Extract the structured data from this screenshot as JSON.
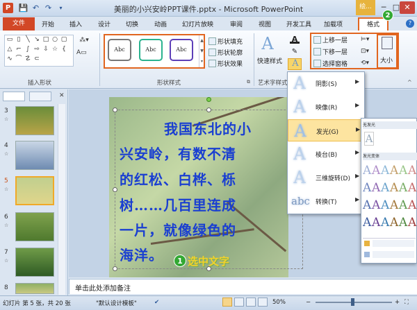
{
  "window": {
    "title": "美丽的小兴安岭PPT课件.pptx - Microsoft PowerPoint",
    "context_tab": "绘..."
  },
  "quick_access": {
    "app_icon": "P",
    "save": "💾",
    "undo": "↶",
    "redo": "↷"
  },
  "tabs": {
    "file": "文件",
    "items": [
      "开始",
      "插入",
      "设计",
      "切换",
      "动画",
      "幻灯片放映",
      "审阅",
      "视图",
      "开发工具",
      "加载项"
    ],
    "format": "格式"
  },
  "badges": {
    "badge1": "1",
    "badge1_text": "选中文字",
    "badge2": "2"
  },
  "ribbon": {
    "insert_shapes_label": "插入形状",
    "shape_styles_label": "形状样式",
    "wordart_label": "艺术字样式",
    "style_thumb": "Abc",
    "fill": "形状填充",
    "outline": "形状轮廓",
    "effects": "形状效果",
    "quick_styles": "快速样式",
    "bring_forward": "上移一层",
    "send_backward": "下移一层",
    "selection_pane": "选择窗格",
    "size": "大小"
  },
  "slides": [
    {
      "num": "3"
    },
    {
      "num": "4"
    },
    {
      "num": "5"
    },
    {
      "num": "6"
    },
    {
      "num": "7"
    },
    {
      "num": "8"
    }
  ],
  "slide_text": {
    "line1": "我国东北的小",
    "line2": "兴安岭，有数不清",
    "line3": "的红松、白桦、栎",
    "line4": "树……几百里连成",
    "line5": "一片，就像绿色的",
    "line6": "海洋。"
  },
  "fx_menu": {
    "shadow": "阴影(S)",
    "reflection": "映像(R)",
    "glow": "发光(G)",
    "bevel": "棱台(B)",
    "rotation": "三维旋转(D)",
    "transform": "转换(T)"
  },
  "sub_menu": {
    "head1": "无发光",
    "head2": "发光变体"
  },
  "notes": {
    "placeholder": "单击此处添加备注"
  },
  "status": {
    "slide_info": "幻灯片 第 5 张，共 20 张",
    "theme": "\"默认设计模板\"",
    "zoom": "50%"
  },
  "colors": {
    "accent": "#e1651f",
    "file_tab": "#d24726",
    "slide_text": "#1a3fd1"
  }
}
